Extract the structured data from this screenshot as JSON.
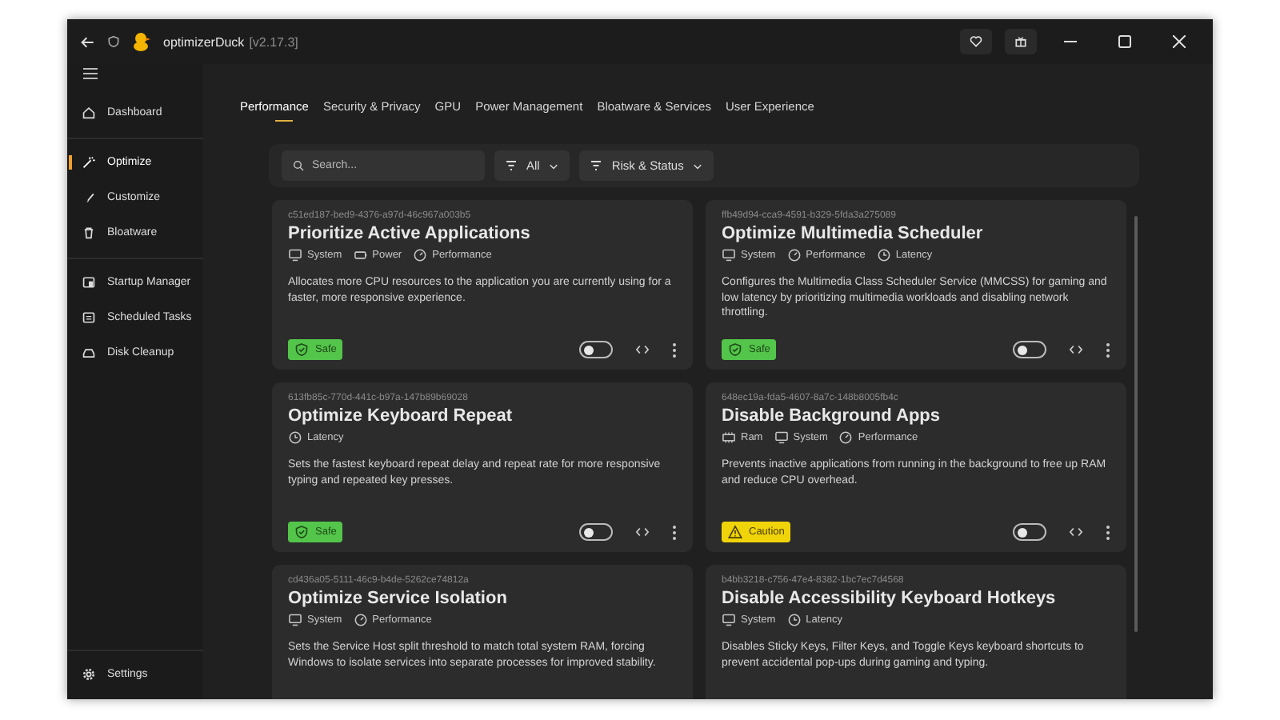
{
  "window": {
    "title": "optimizerDuck",
    "version": "[v2.17.3]"
  },
  "sidebar": {
    "groups": [
      {
        "items": [
          {
            "kind": "home",
            "label": "Dashboard",
            "selected": false
          }
        ]
      },
      {
        "items": [
          {
            "kind": "wand",
            "label": "Optimize",
            "selected": true
          },
          {
            "kind": "brush",
            "label": "Customize",
            "selected": false
          },
          {
            "kind": "trash",
            "label": "Bloatware",
            "selected": false
          }
        ]
      },
      {
        "items": [
          {
            "kind": "startup",
            "label": "Startup Manager",
            "selected": false
          },
          {
            "kind": "tasks",
            "label": "Scheduled Tasks",
            "selected": false
          },
          {
            "kind": "disk",
            "label": "Disk Cleanup",
            "selected": false
          }
        ]
      }
    ],
    "footer": {
      "kind": "gear",
      "label": "Settings",
      "selected": false
    }
  },
  "tabs": [
    {
      "label": "Performance",
      "selected": true
    },
    {
      "label": "Security & Privacy",
      "selected": false
    },
    {
      "label": "GPU",
      "selected": false
    },
    {
      "label": "Power Management",
      "selected": false
    },
    {
      "label": "Bloatware & Services",
      "selected": false
    },
    {
      "label": "User Experience",
      "selected": false
    }
  ],
  "filters": {
    "search": {
      "placeholder": "Search..."
    },
    "dropdowns": [
      {
        "label": "All"
      },
      {
        "label": "Risk & Status"
      }
    ]
  },
  "cards": [
    {
      "id": "c51ed187-bed9-4376-a97d-46c967a003b5",
      "title": "Prioritize Active Applications",
      "tags": [
        {
          "kind": "system",
          "label": "System"
        },
        {
          "kind": "power",
          "label": "Power"
        },
        {
          "kind": "performance",
          "label": "Performance"
        }
      ],
      "description": "Allocates more CPU resources to the application you are currently using for a faster, more responsive experience.",
      "badge": {
        "kind": "safe",
        "label": "Safe"
      },
      "on": false
    },
    {
      "id": "ffb49d94-cca9-4591-b329-5fda3a275089",
      "title": "Optimize Multimedia Scheduler",
      "tags": [
        {
          "kind": "system",
          "label": "System"
        },
        {
          "kind": "performance",
          "label": "Performance"
        },
        {
          "kind": "latency",
          "label": "Latency"
        }
      ],
      "description": "Configures the Multimedia Class Scheduler Service (MMCSS) for gaming and low latency by prioritizing multimedia workloads and disabling network throttling.",
      "badge": {
        "kind": "safe",
        "label": "Safe"
      },
      "on": false
    },
    {
      "id": "613fb85c-770d-441c-b97a-147b89b69028",
      "title": "Optimize Keyboard Repeat",
      "tags": [
        {
          "kind": "latency",
          "label": "Latency"
        }
      ],
      "description": "Sets the fastest keyboard repeat delay and repeat rate for more responsive typing and repeated key presses.",
      "badge": {
        "kind": "safe",
        "label": "Safe"
      },
      "on": false
    },
    {
      "id": "648ec19a-fda5-4607-8a7c-148b8005fb4c",
      "title": "Disable Background Apps",
      "tags": [
        {
          "kind": "ram",
          "label": "Ram"
        },
        {
          "kind": "system",
          "label": "System"
        },
        {
          "kind": "performance",
          "label": "Performance"
        }
      ],
      "description": "Prevents inactive applications from running in the background to free up RAM and reduce CPU overhead.",
      "badge": {
        "kind": "caution",
        "label": "Caution"
      },
      "on": false
    },
    {
      "id": "cd436a05-5111-46c9-b4de-5262ce74812a",
      "title": "Optimize Service Isolation",
      "tags": [
        {
          "kind": "system",
          "label": "System"
        },
        {
          "kind": "performance",
          "label": "Performance"
        }
      ],
      "description": "Sets the Service Host split threshold to match total system RAM, forcing Windows to isolate services into separate processes for improved stability."
    },
    {
      "id": "b4bb3218-c756-47e4-8382-1bc7ec7d4568",
      "title": "Disable Accessibility Keyboard Hotkeys",
      "tags": [
        {
          "kind": "system",
          "label": "System"
        },
        {
          "kind": "latency",
          "label": "Latency"
        }
      ],
      "description": "Disables Sticky Keys, Filter Keys, and Toggle Keys keyboard shortcuts to prevent accidental pop-ups during gaming and typing."
    }
  ]
}
